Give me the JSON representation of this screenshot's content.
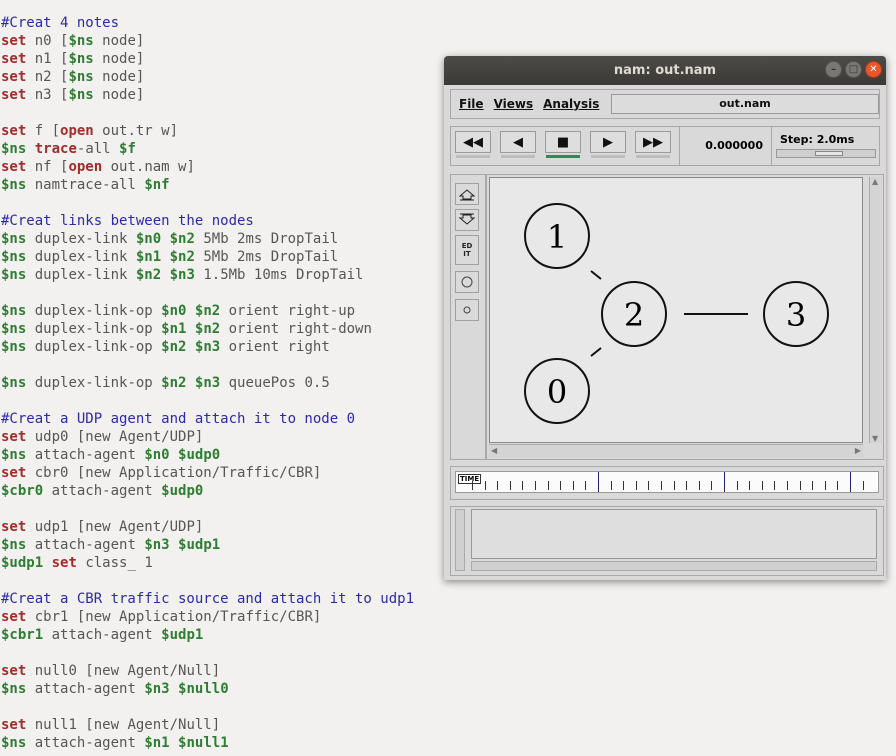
{
  "editor": {
    "lines": [
      [
        {
          "t": "#Creat 4 notes",
          "c": "comment"
        }
      ],
      [
        {
          "t": "set",
          "c": "keyword"
        },
        {
          "t": " n0 [",
          "c": "text"
        },
        {
          "t": "$ns",
          "c": "var"
        },
        {
          "t": " node]",
          "c": "text"
        }
      ],
      [
        {
          "t": "set",
          "c": "keyword"
        },
        {
          "t": " n1 [",
          "c": "text"
        },
        {
          "t": "$ns",
          "c": "var"
        },
        {
          "t": " node]",
          "c": "text"
        }
      ],
      [
        {
          "t": "set",
          "c": "keyword"
        },
        {
          "t": " n2 [",
          "c": "text"
        },
        {
          "t": "$ns",
          "c": "var"
        },
        {
          "t": " node]",
          "c": "text"
        }
      ],
      [
        {
          "t": "set",
          "c": "keyword"
        },
        {
          "t": " n3 [",
          "c": "text"
        },
        {
          "t": "$ns",
          "c": "var"
        },
        {
          "t": " node]",
          "c": "text"
        }
      ],
      [],
      [
        {
          "t": "set",
          "c": "keyword"
        },
        {
          "t": " f [",
          "c": "text"
        },
        {
          "t": "open",
          "c": "keyword"
        },
        {
          "t": " out.tr w]",
          "c": "text"
        }
      ],
      [
        {
          "t": "$ns",
          "c": "var"
        },
        {
          "t": " ",
          "c": "text"
        },
        {
          "t": "trace",
          "c": "keyword"
        },
        {
          "t": "-all ",
          "c": "text"
        },
        {
          "t": "$f",
          "c": "var"
        }
      ],
      [
        {
          "t": "set",
          "c": "keyword"
        },
        {
          "t": " nf [",
          "c": "text"
        },
        {
          "t": "open",
          "c": "keyword"
        },
        {
          "t": " out.nam w]",
          "c": "text"
        }
      ],
      [
        {
          "t": "$ns",
          "c": "var"
        },
        {
          "t": " namtrace-all ",
          "c": "text"
        },
        {
          "t": "$nf",
          "c": "var"
        }
      ],
      [],
      [
        {
          "t": "#Creat links between the nodes",
          "c": "comment"
        }
      ],
      [
        {
          "t": "$ns",
          "c": "var"
        },
        {
          "t": " duplex-link ",
          "c": "text"
        },
        {
          "t": "$n0",
          "c": "var"
        },
        {
          "t": " ",
          "c": "text"
        },
        {
          "t": "$n2",
          "c": "var"
        },
        {
          "t": " 5Mb 2ms DropTail",
          "c": "text"
        }
      ],
      [
        {
          "t": "$ns",
          "c": "var"
        },
        {
          "t": " duplex-link ",
          "c": "text"
        },
        {
          "t": "$n1",
          "c": "var"
        },
        {
          "t": " ",
          "c": "text"
        },
        {
          "t": "$n2",
          "c": "var"
        },
        {
          "t": " 5Mb 2ms DropTail",
          "c": "text"
        }
      ],
      [
        {
          "t": "$ns",
          "c": "var"
        },
        {
          "t": " duplex-link ",
          "c": "text"
        },
        {
          "t": "$n2",
          "c": "var"
        },
        {
          "t": " ",
          "c": "text"
        },
        {
          "t": "$n3",
          "c": "var"
        },
        {
          "t": " 1.5Mb 10ms DropTail",
          "c": "text"
        }
      ],
      [],
      [
        {
          "t": "$ns",
          "c": "var"
        },
        {
          "t": " duplex-link-op ",
          "c": "text"
        },
        {
          "t": "$n0",
          "c": "var"
        },
        {
          "t": " ",
          "c": "text"
        },
        {
          "t": "$n2",
          "c": "var"
        },
        {
          "t": " orient right-up",
          "c": "text"
        }
      ],
      [
        {
          "t": "$ns",
          "c": "var"
        },
        {
          "t": " duplex-link-op ",
          "c": "text"
        },
        {
          "t": "$n1",
          "c": "var"
        },
        {
          "t": " ",
          "c": "text"
        },
        {
          "t": "$n2",
          "c": "var"
        },
        {
          "t": " orient right-down",
          "c": "text"
        }
      ],
      [
        {
          "t": "$ns",
          "c": "var"
        },
        {
          "t": " duplex-link-op ",
          "c": "text"
        },
        {
          "t": "$n2",
          "c": "var"
        },
        {
          "t": " ",
          "c": "text"
        },
        {
          "t": "$n3",
          "c": "var"
        },
        {
          "t": " orient right",
          "c": "text"
        }
      ],
      [],
      [
        {
          "t": "$ns",
          "c": "var"
        },
        {
          "t": " duplex-link-op ",
          "c": "text"
        },
        {
          "t": "$n2",
          "c": "var"
        },
        {
          "t": " ",
          "c": "text"
        },
        {
          "t": "$n3",
          "c": "var"
        },
        {
          "t": " queuePos 0.5",
          "c": "text"
        }
      ],
      [],
      [
        {
          "t": "#Creat a UDP agent and attach it to node 0",
          "c": "comment"
        }
      ],
      [
        {
          "t": "set",
          "c": "keyword"
        },
        {
          "t": " udp0 [new Agent/UDP]",
          "c": "text"
        }
      ],
      [
        {
          "t": "$ns",
          "c": "var"
        },
        {
          "t": " attach-agent ",
          "c": "text"
        },
        {
          "t": "$n0",
          "c": "var"
        },
        {
          "t": " ",
          "c": "text"
        },
        {
          "t": "$udp0",
          "c": "var"
        }
      ],
      [
        {
          "t": "set",
          "c": "keyword"
        },
        {
          "t": " cbr0 [new Application/Traffic/CBR]",
          "c": "text"
        }
      ],
      [
        {
          "t": "$cbr0",
          "c": "var"
        },
        {
          "t": " attach-agent ",
          "c": "text"
        },
        {
          "t": "$udp0",
          "c": "var"
        }
      ],
      [],
      [
        {
          "t": "set",
          "c": "keyword"
        },
        {
          "t": " udp1 [new Agent/UDP]",
          "c": "text"
        }
      ],
      [
        {
          "t": "$ns",
          "c": "var"
        },
        {
          "t": " attach-agent ",
          "c": "text"
        },
        {
          "t": "$n3",
          "c": "var"
        },
        {
          "t": " ",
          "c": "text"
        },
        {
          "t": "$udp1",
          "c": "var"
        }
      ],
      [
        {
          "t": "$udp1",
          "c": "var"
        },
        {
          "t": " ",
          "c": "text"
        },
        {
          "t": "set",
          "c": "keyword"
        },
        {
          "t": " class_ 1",
          "c": "text"
        }
      ],
      [],
      [
        {
          "t": "#Creat a CBR traffic source and attach it to udp1",
          "c": "comment"
        }
      ],
      [
        {
          "t": "set",
          "c": "keyword"
        },
        {
          "t": " cbr1 [new Application/Traffic/CBR]",
          "c": "text"
        }
      ],
      [
        {
          "t": "$cbr1",
          "c": "var"
        },
        {
          "t": " attach-agent ",
          "c": "text"
        },
        {
          "t": "$udp1",
          "c": "var"
        }
      ],
      [],
      [
        {
          "t": "set",
          "c": "keyword"
        },
        {
          "t": " null0 [new Agent/Null]",
          "c": "text"
        }
      ],
      [
        {
          "t": "$ns",
          "c": "var"
        },
        {
          "t": " attach-agent ",
          "c": "text"
        },
        {
          "t": "$n3",
          "c": "var"
        },
        {
          "t": " ",
          "c": "text"
        },
        {
          "t": "$null0",
          "c": "var"
        }
      ],
      [],
      [
        {
          "t": "set",
          "c": "keyword"
        },
        {
          "t": " null1 [new Agent/Null]",
          "c": "text"
        }
      ],
      [
        {
          "t": "$ns",
          "c": "var"
        },
        {
          "t": " attach-agent ",
          "c": "text"
        },
        {
          "t": "$n1",
          "c": "var"
        },
        {
          "t": " ",
          "c": "text"
        },
        {
          "t": "$null1",
          "c": "var"
        }
      ]
    ]
  },
  "nam": {
    "title": "nam: out.nam",
    "menus": [
      "File",
      "Views",
      "Analysis"
    ],
    "file_display": "out.nam",
    "controls": {
      "rewind": "◀◀",
      "back": "◀",
      "stop": "■",
      "play": "▶",
      "fastforward": "▶▶"
    },
    "time": "0.000000",
    "step_label": "Step: 2.0ms",
    "tools": {
      "edit_label": "ED\nIT"
    },
    "nodes": [
      "1",
      "2",
      "3",
      "0"
    ],
    "timeline_label": "TIME"
  },
  "colors": {
    "comment": "#2a2aaa",
    "keyword": "#a52a2a",
    "variable": "#2e7d32",
    "close_button": "#e9562b"
  }
}
